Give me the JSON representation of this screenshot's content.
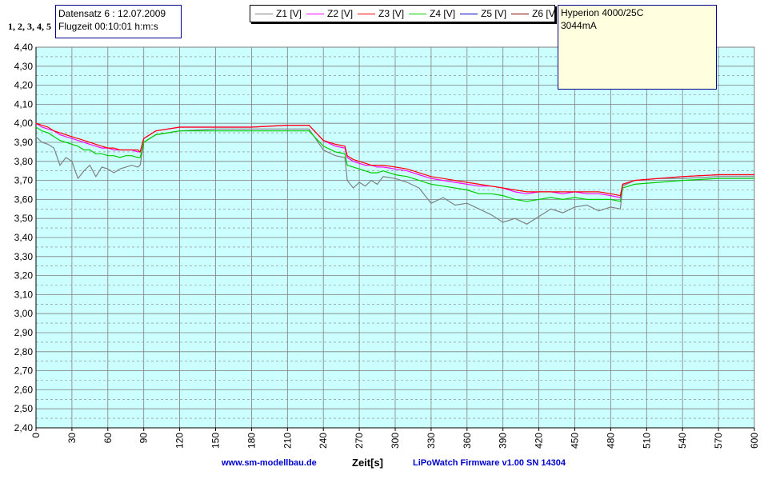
{
  "info": {
    "dataset": "Datensatz 6 : 12.07.2009",
    "flight_time": "Flugzeit 00:10:01 h:m:s"
  },
  "cells_label": "1, 2, 3, 4, 5",
  "note": {
    "line1": "Hyperion 4000/25C",
    "line2": "3044mA"
  },
  "footer": {
    "website": "www.sm-modellbau.de",
    "xaxis_label": "Zeit[s]",
    "firmware": "LiPoWatch Firmware v1.00 SN 14304"
  },
  "colors": {
    "plot_bg": "#ccffff",
    "grid": "#808080",
    "Z1": "#808080",
    "Z2": "#ff00ff",
    "Z3": "#ff0000",
    "Z4": "#00cc00",
    "Z5": "#0000cc",
    "Z6": "#800000"
  },
  "chart_data": {
    "type": "line",
    "xlabel": "Zeit[s]",
    "ylabel": "",
    "xlim": [
      0,
      600
    ],
    "ylim": [
      2.4,
      4.4
    ],
    "x_ticks": [
      0,
      30,
      60,
      90,
      120,
      150,
      180,
      210,
      240,
      270,
      300,
      330,
      360,
      390,
      420,
      450,
      480,
      510,
      540,
      570,
      600
    ],
    "y_ticks": [
      "2,40",
      "2,50",
      "2,60",
      "2,70",
      "2,80",
      "2,90",
      "3,00",
      "3,10",
      "3,20",
      "3,30",
      "3,40",
      "3,50",
      "3,60",
      "3,70",
      "3,80",
      "3,90",
      "4,00",
      "4,10",
      "4,20",
      "4,30",
      "4,40"
    ],
    "grid": true,
    "legend_position": "top",
    "x": [
      0,
      5,
      10,
      15,
      20,
      25,
      30,
      35,
      40,
      45,
      50,
      55,
      60,
      65,
      70,
      75,
      80,
      85,
      87,
      90,
      100,
      120,
      150,
      180,
      210,
      228,
      240,
      250,
      258,
      260,
      265,
      270,
      275,
      280,
      285,
      290,
      300,
      310,
      320,
      330,
      340,
      350,
      360,
      370,
      380,
      390,
      400,
      410,
      420,
      430,
      440,
      450,
      460,
      470,
      480,
      488,
      490,
      500,
      520,
      540,
      570,
      600
    ],
    "series": [
      {
        "name": "Z1 [V]",
        "values": [
          3.93,
          3.9,
          3.89,
          3.87,
          3.78,
          3.82,
          3.8,
          3.71,
          3.75,
          3.78,
          3.72,
          3.77,
          3.76,
          3.74,
          3.76,
          3.77,
          3.78,
          3.77,
          3.78,
          3.9,
          3.94,
          3.96,
          3.97,
          3.97,
          3.97,
          3.97,
          3.86,
          3.83,
          3.82,
          3.7,
          3.66,
          3.69,
          3.67,
          3.7,
          3.68,
          3.72,
          3.71,
          3.69,
          3.66,
          3.58,
          3.61,
          3.57,
          3.58,
          3.55,
          3.52,
          3.48,
          3.5,
          3.47,
          3.51,
          3.55,
          3.53,
          3.56,
          3.57,
          3.54,
          3.56,
          3.55,
          3.67,
          3.7,
          3.71,
          3.71,
          3.72,
          3.72
        ]
      },
      {
        "name": "Z2 [V]",
        "values": [
          4.0,
          3.98,
          3.97,
          3.96,
          3.94,
          3.93,
          3.92,
          3.91,
          3.9,
          3.89,
          3.88,
          3.87,
          3.87,
          3.86,
          3.86,
          3.86,
          3.86,
          3.85,
          3.85,
          3.92,
          3.96,
          3.98,
          3.98,
          3.98,
          3.99,
          3.99,
          3.91,
          3.88,
          3.87,
          3.82,
          3.8,
          3.79,
          3.78,
          3.78,
          3.77,
          3.77,
          3.76,
          3.75,
          3.73,
          3.71,
          3.7,
          3.69,
          3.68,
          3.67,
          3.67,
          3.66,
          3.64,
          3.63,
          3.64,
          3.64,
          3.63,
          3.64,
          3.63,
          3.63,
          3.62,
          3.61,
          3.68,
          3.7,
          3.71,
          3.72,
          3.73,
          3.73
        ]
      },
      {
        "name": "Z3 [V]",
        "values": [
          4.0,
          3.99,
          3.98,
          3.96,
          3.95,
          3.94,
          3.93,
          3.92,
          3.91,
          3.9,
          3.89,
          3.88,
          3.87,
          3.87,
          3.86,
          3.86,
          3.86,
          3.86,
          3.85,
          3.92,
          3.96,
          3.98,
          3.98,
          3.98,
          3.99,
          3.99,
          3.91,
          3.89,
          3.88,
          3.83,
          3.81,
          3.8,
          3.79,
          3.78,
          3.78,
          3.78,
          3.77,
          3.76,
          3.74,
          3.72,
          3.71,
          3.7,
          3.69,
          3.68,
          3.67,
          3.66,
          3.65,
          3.64,
          3.64,
          3.64,
          3.64,
          3.64,
          3.64,
          3.64,
          3.63,
          3.62,
          3.68,
          3.7,
          3.71,
          3.72,
          3.73,
          3.73
        ]
      },
      {
        "name": "Z4 [V]",
        "values": [
          3.98,
          3.96,
          3.95,
          3.93,
          3.91,
          3.9,
          3.89,
          3.88,
          3.86,
          3.86,
          3.84,
          3.84,
          3.83,
          3.83,
          3.82,
          3.83,
          3.83,
          3.82,
          3.82,
          3.9,
          3.94,
          3.96,
          3.96,
          3.96,
          3.96,
          3.96,
          3.88,
          3.85,
          3.84,
          3.78,
          3.77,
          3.76,
          3.75,
          3.74,
          3.74,
          3.75,
          3.73,
          3.72,
          3.7,
          3.68,
          3.67,
          3.66,
          3.65,
          3.63,
          3.63,
          3.62,
          3.6,
          3.59,
          3.6,
          3.61,
          3.6,
          3.61,
          3.6,
          3.6,
          3.6,
          3.59,
          3.66,
          3.68,
          3.69,
          3.7,
          3.71,
          3.71
        ]
      },
      {
        "name": "Z5 [V]",
        "values": []
      },
      {
        "name": "Z6 [V]",
        "values": []
      }
    ]
  }
}
